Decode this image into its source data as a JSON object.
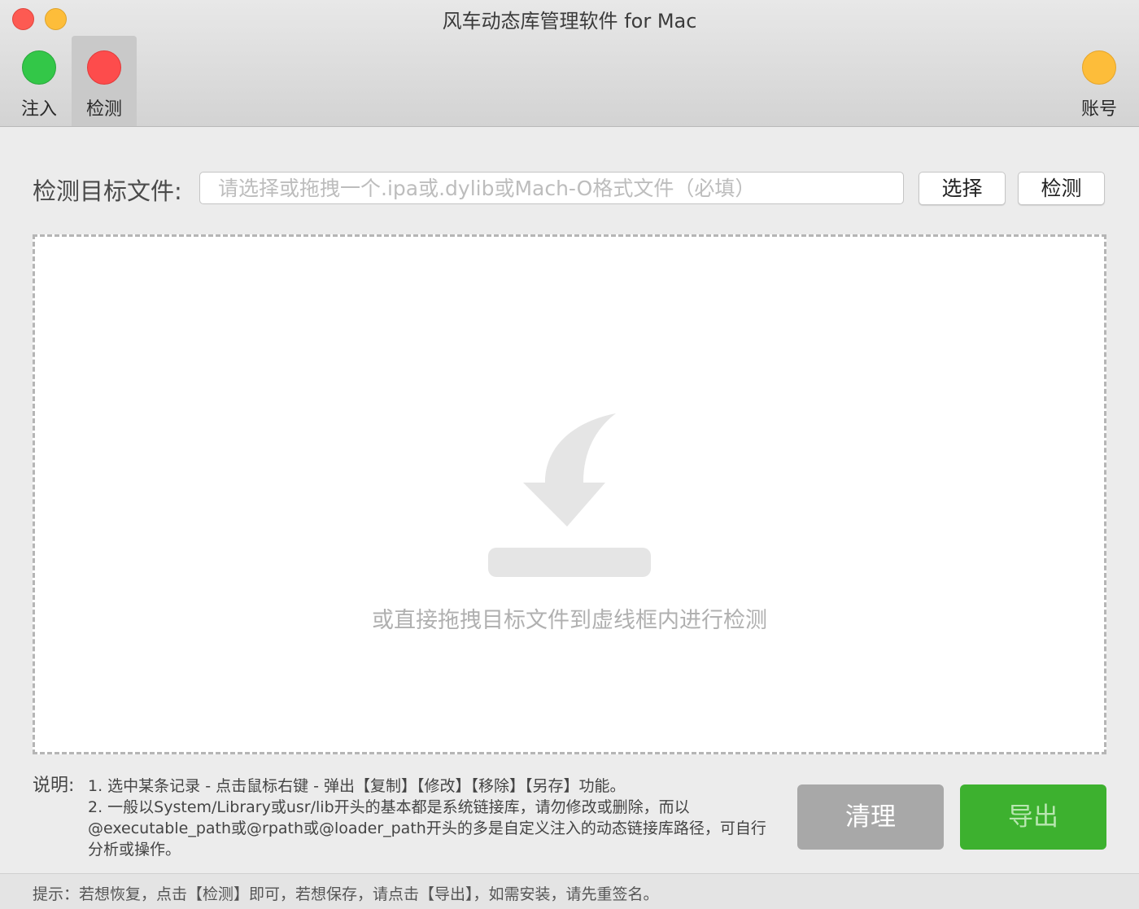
{
  "window": {
    "title": "风车动态库管理软件 for Mac"
  },
  "toolbar": {
    "inject_label": "注入",
    "detect_label": "检测",
    "account_label": "账号"
  },
  "target": {
    "label": "检测目标文件:",
    "placeholder": "请选择或拖拽一个.ipa或.dylib或Mach-O格式文件（必填）",
    "value": "",
    "choose_label": "选择",
    "detect_label": "检测"
  },
  "dropzone": {
    "icon": "download-arrow-icon",
    "text": "或直接拖拽目标文件到虚线框内进行检测"
  },
  "notes": {
    "label": "说明:",
    "lines": [
      "1. 选中某条记录 - 点击鼠标右键 - 弹出【复制】【修改】【移除】【另存】功能。",
      "2. 一般以System/Library或usr/lib开头的基本都是系统链接库，请勿修改或删除，而以@executable_path或@rpath或@loader_path开头的多是自定义注入的动态链接库路径，可自行分析或操作。"
    ]
  },
  "actions": {
    "clear_label": "清理",
    "export_label": "导出"
  },
  "status": {
    "text": "提示：若想恢复，点击【检测】即可，若想保存，请点击【导出】，如需安装，请先重签名。"
  },
  "colors": {
    "inject_dot": "#33c748",
    "detect_dot": "#fd4c4c",
    "account_dot": "#fdbd3a",
    "export_button": "#3db12f",
    "clear_button": "#a8a8a8"
  }
}
